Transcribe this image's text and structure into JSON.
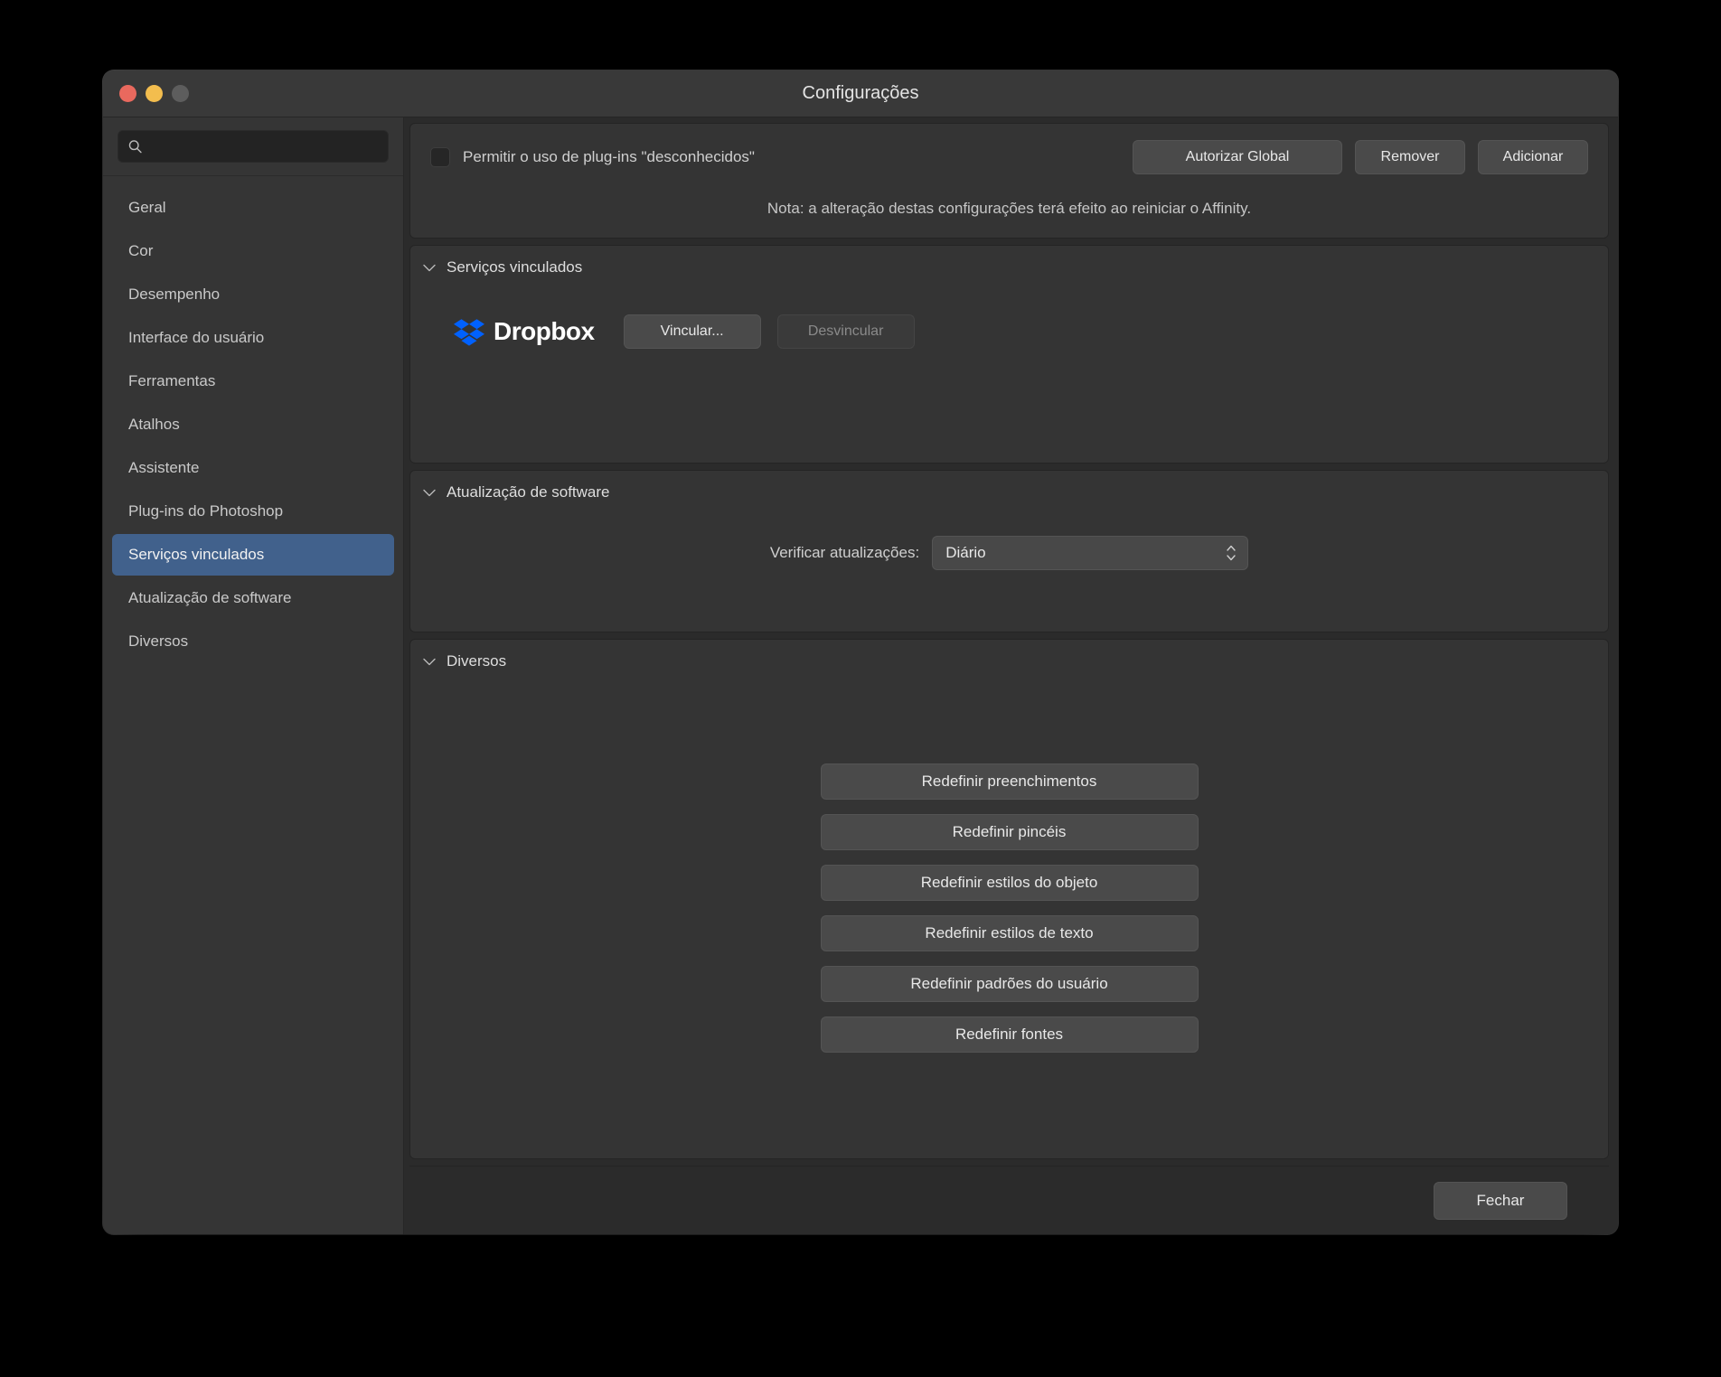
{
  "window": {
    "title": "Configurações",
    "traffic_lights": [
      "close-button",
      "minimize-button",
      "zoom-button"
    ]
  },
  "sidebar": {
    "search": {
      "value": "",
      "placeholder": ""
    },
    "items": [
      {
        "label": "Geral",
        "selected": false
      },
      {
        "label": "Cor",
        "selected": false
      },
      {
        "label": "Desempenho",
        "selected": false
      },
      {
        "label": "Interface do usuário",
        "selected": false
      },
      {
        "label": "Ferramentas",
        "selected": false
      },
      {
        "label": "Atalhos",
        "selected": false
      },
      {
        "label": "Assistente",
        "selected": false
      },
      {
        "label": "Plug-ins do Photoshop",
        "selected": false
      },
      {
        "label": "Serviços vinculados",
        "selected": true
      },
      {
        "label": "Atualização de software",
        "selected": false
      },
      {
        "label": "Diversos",
        "selected": false
      }
    ]
  },
  "plugins_panel": {
    "checkbox_label": "Permitir o uso de plug-ins \"desconhecidos\"",
    "checkbox_checked": false,
    "authorize_global_label": "Autorizar Global",
    "remove_label": "Remover",
    "add_label": "Adicionar",
    "note": "Nota: a alteração destas configurações terá efeito ao reiniciar o Affinity."
  },
  "linked_services": {
    "section_title": "Serviços vinculados",
    "service_name": "Dropbox",
    "link_label": "Vincular...",
    "unlink_label": "Desvincular",
    "unlink_disabled": true
  },
  "software_update": {
    "section_title": "Atualização de software",
    "field_label": "Verificar atualizações:",
    "selected_value": "Diário"
  },
  "misc": {
    "section_title": "Diversos",
    "buttons": [
      "Redefinir preenchimentos",
      "Redefinir pincéis",
      "Redefinir estilos do objeto",
      "Redefinir estilos de texto",
      "Redefinir padrões do usuário",
      "Redefinir fontes"
    ]
  },
  "footer": {
    "close_label": "Fechar"
  },
  "colors": {
    "accent_selection": "#41618c",
    "window_bg": "#323232",
    "panel_bg": "#343434",
    "content_bg": "#2b2b2b",
    "dropbox_blue": "#0061ff",
    "traffic_close": "#e9695e",
    "traffic_min": "#f3bd4e",
    "traffic_zoom": "#5d5d5d"
  }
}
